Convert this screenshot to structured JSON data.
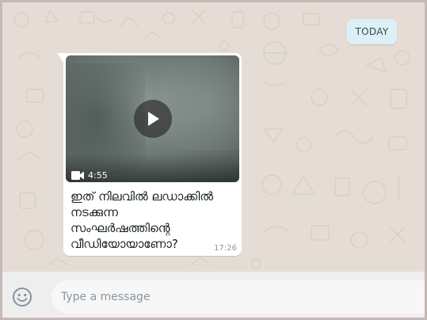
{
  "date_chip": {
    "label": "TODAY"
  },
  "message": {
    "video": {
      "duration": "4:55"
    },
    "caption_lines": [
      "ഇത് നിലവിൽ ലഡാക്കിൽ",
      "നടക്കുന്ന",
      "സംഘർഷത്തിന്റെ",
      "വീഡിയോയാണോ?"
    ],
    "time": "17:26"
  },
  "composer": {
    "placeholder": "Type a message"
  },
  "icons": {
    "play": "play-icon",
    "video": "video-camera-icon",
    "emoji": "smiley-icon"
  },
  "colors": {
    "chat_background": "#e5ddd5",
    "bubble": "#ffffff",
    "date_chip": "#dcf0f6",
    "footer": "#eeeeee",
    "frame": "#c6b8b4"
  }
}
